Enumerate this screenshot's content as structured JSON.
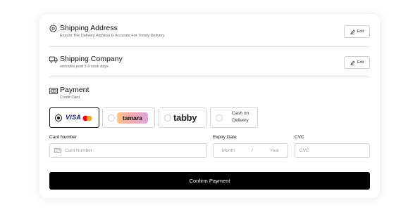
{
  "shipping_address": {
    "title": "Shipping Address",
    "subtitle": "Ensure The Delivery Address Is Accurate For Timely Delivery.",
    "edit_label": "Edit"
  },
  "shipping_company": {
    "title": "Shipping Company",
    "subtitle": "emirates post 3-5 work days",
    "edit_label": "Edit"
  },
  "payment": {
    "title": "Payment",
    "subtitle": "Credit Card",
    "methods": {
      "visa": {
        "label": "VISA",
        "selected": true
      },
      "tamara": {
        "label": "tamara",
        "selected": false
      },
      "tabby": {
        "label": "tabby",
        "selected": false
      },
      "cod": {
        "label": "Cash on Delivery",
        "selected": false
      }
    }
  },
  "form": {
    "card_number_label": "Card Number",
    "card_number_placeholder": "Card Number",
    "expiry_label": "Expiry Date",
    "month_placeholder": "Month",
    "separator": "/",
    "year_placeholder": "Year",
    "cvc_label": "CVC",
    "cvc_placeholder": "CVC"
  },
  "confirm_label": "Confirm Payment",
  "colors": {
    "primary_button": "#000000",
    "visa_blue": "#1a1f71",
    "mastercard_red": "#eb001b",
    "mastercard_orange": "#f79e1b"
  }
}
